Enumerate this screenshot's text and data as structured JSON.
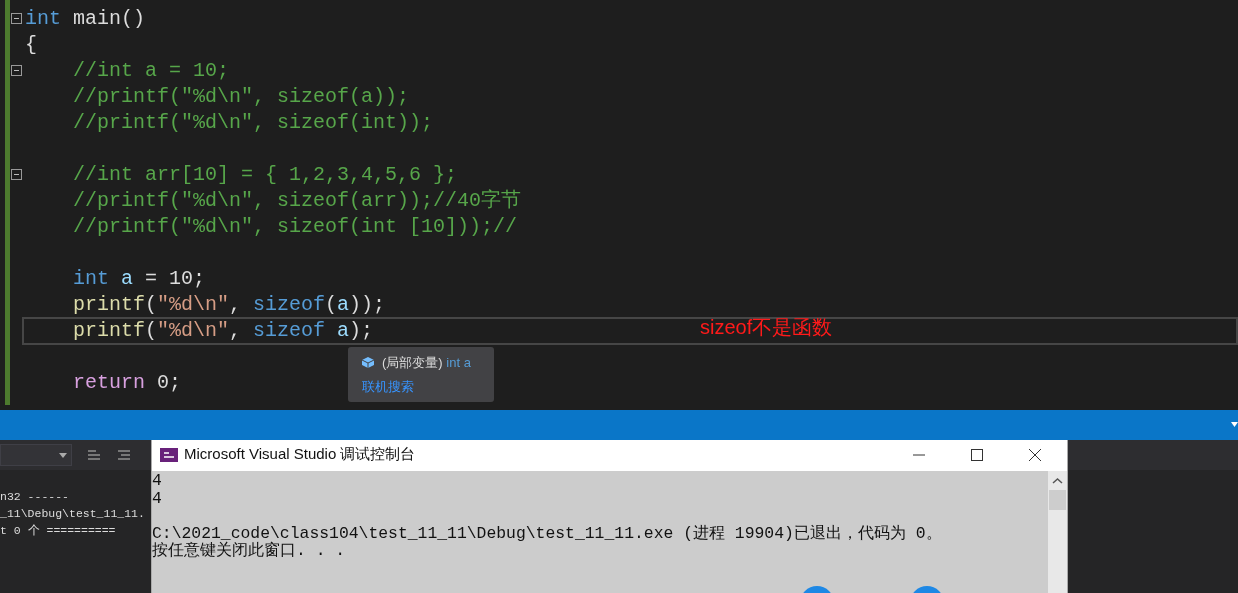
{
  "editor": {
    "lines": [
      {
        "fold": true,
        "current": false,
        "tokens": [
          {
            "text": "int",
            "kind": "keyword"
          },
          {
            "text": " main()",
            "kind": "plain"
          }
        ]
      },
      {
        "fold": false,
        "current": false,
        "tokens": [
          {
            "text": "{",
            "kind": "plain"
          }
        ],
        "body": [
          [
            {
              "fold": true,
              "current": false,
              "tokens": [
                {
                  "text": "//int a = 10;",
                  "kind": "comment"
                }
              ]
            },
            {
              "fold": false,
              "current": false,
              "tokens": [
                {
                  "text": "//printf(\"%d\\n\", sizeof(a));",
                  "kind": "comment"
                }
              ]
            },
            {
              "fold": false,
              "current": false,
              "tokens": [
                {
                  "text": "//printf(\"%d\\n\", sizeof(int));",
                  "kind": "comment"
                }
              ]
            }
          ],
          [
            {
              "fold": true,
              "current": false,
              "tokens": [
                {
                  "text": "//int arr[10] = { 1,2,3,4,5,6 };",
                  "kind": "comment"
                }
              ]
            },
            {
              "fold": false,
              "current": false,
              "tokens": [
                {
                  "text": "//printf(\"%d\\n\", sizeof(arr));//40字节",
                  "kind": "comment"
                }
              ]
            },
            {
              "fold": false,
              "current": false,
              "tokens": [
                {
                  "text": "//printf(\"%d\\n\", sizeof(int [10]));//",
                  "kind": "comment"
                }
              ]
            }
          ],
          [
            {
              "fold": false,
              "current": false,
              "tokens": [
                {
                  "text": "int ",
                  "kind": "keyword"
                },
                {
                  "text": "a",
                  "kind": "variable"
                },
                {
                  "text": " = 10;",
                  "kind": "plain"
                }
              ]
            },
            {
              "fold": false,
              "current": false,
              "tokens": [
                {
                  "text": "printf",
                  "kind": "function"
                },
                {
                  "text": "(",
                  "kind": "plain"
                },
                {
                  "text": "\"%d\\n\"",
                  "kind": "string"
                },
                {
                  "text": ", ",
                  "kind": "plain"
                },
                {
                  "text": "sizeof",
                  "kind": "keyword"
                },
                {
                  "text": "(",
                  "kind": "plain"
                },
                {
                  "text": "a",
                  "kind": "variable"
                },
                {
                  "text": "));",
                  "kind": "plain"
                }
              ]
            },
            {
              "fold": false,
              "current": true,
              "tokens": [
                {
                  "text": "printf",
                  "kind": "function"
                },
                {
                  "text": "(",
                  "kind": "plain"
                },
                {
                  "text": "\"%d\\n\"",
                  "kind": "string"
                },
                {
                  "text": ", ",
                  "kind": "plain"
                },
                {
                  "text": "sizeof ",
                  "kind": "keyword"
                },
                {
                  "text": "a",
                  "kind": "variable"
                },
                {
                  "text": ");",
                  "kind": "plain"
                }
              ]
            }
          ],
          [
            {
              "fold": false,
              "current": false,
              "tokens": [
                {
                  "text": "return",
                  "kind": "control"
                },
                {
                  "text": " 0;",
                  "kind": "plain"
                }
              ]
            }
          ]
        ]
      }
    ]
  },
  "tooltip": {
    "label": "(局部变量)",
    "type": "int a",
    "link": "联机搜索"
  },
  "annotation": "sizeof不是函数",
  "output_panel": {
    "lines": [
      "n32 ------",
      "_11\\Debug\\test_11_11.",
      "t 0 个 =========="
    ]
  },
  "console": {
    "title": "Microsoft Visual Studio 调试控制台",
    "blocks": [
      [
        "4",
        "4"
      ],
      [
        "C:\\2021_code\\class104\\test_11_11\\Debug\\test_11_11.exe (进程 19904)已退出，代码为 0。",
        "按任意键关闭此窗口. . ."
      ]
    ]
  }
}
